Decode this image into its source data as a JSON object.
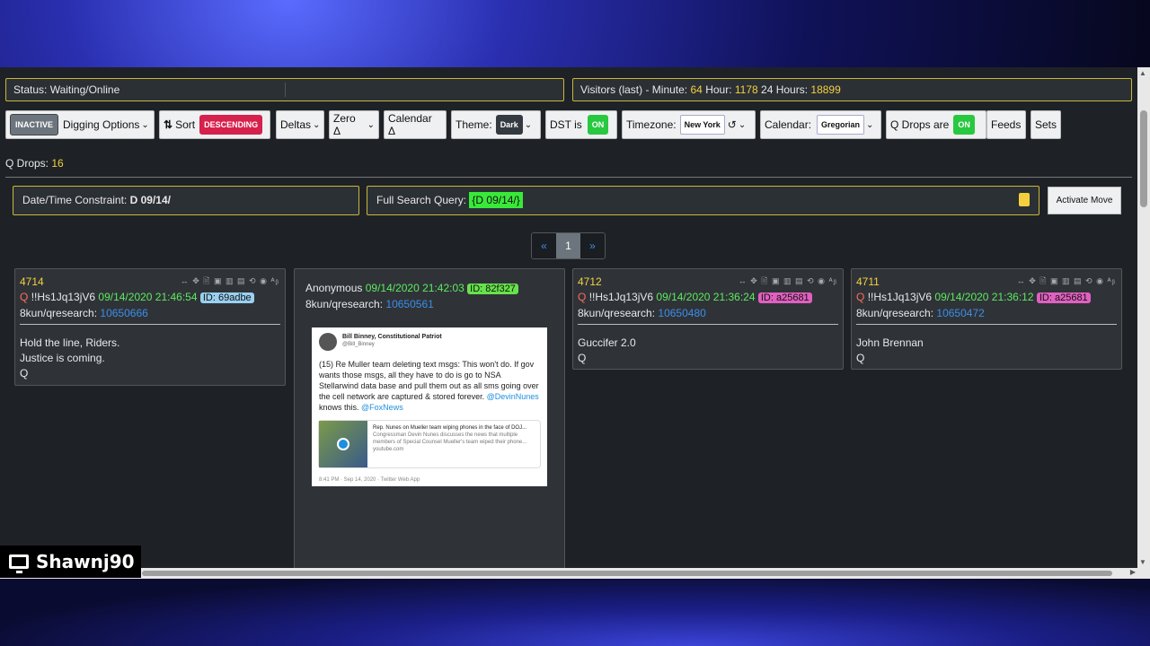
{
  "status": {
    "label": "Status: Waiting/Online"
  },
  "visitors": {
    "prefix": "Visitors (last) - Minute:",
    "minute": "64",
    "hour_label": "Hour:",
    "hour": "1178",
    "day_label": "24 Hours:",
    "day": "18899"
  },
  "toolbar": {
    "inactive": "INACTIVE",
    "digging": "Digging Options",
    "sort_icon": "sort-arrows-icon",
    "sort": "Sort",
    "descending": "DESCENDING",
    "deltas": "Deltas",
    "zero_delta": "Zero Δ",
    "calendar_delta": "Calendar Δ",
    "theme_label": "Theme:",
    "theme_value": "Dark",
    "dst_label": "DST is",
    "dst_value": "ON",
    "timezone_label": "Timezone:",
    "timezone_value": "New York",
    "calendar_label": "Calendar:",
    "calendar_value": "Gregorian",
    "qdrops_label": "Q Drops are",
    "qdrops_value": "ON",
    "feeds": "Feeds",
    "sets": "Sets"
  },
  "qdrops_count": {
    "label": "Q Drops:",
    "value": "16"
  },
  "constraint": {
    "label": "Date/Time Constraint:",
    "value": "D 09/14/"
  },
  "search": {
    "label": "Full Search Query:",
    "value": "{D 09/14/}"
  },
  "activate": "Activate Move",
  "pager": {
    "prev": "«",
    "page": "1",
    "next": "»"
  },
  "cards": [
    {
      "num": "4714",
      "q": "Q",
      "trip": "!!Hs1Jq13jV6",
      "date": "09/14/2020 21:46:54",
      "id": "ID: 69adbe",
      "board": "8kun/qresearch:",
      "post": "10650666",
      "lines": [
        "Hold the line, Riders.",
        "Justice is coming.",
        "Q"
      ]
    },
    {
      "author": "Anonymous",
      "date": "09/14/2020 21:42:03",
      "id": "ID: 82f327",
      "board": "8kun/qresearch:",
      "post": "10650561",
      "tweet": {
        "name": "Bill Binney, Constitutional Patriot",
        "handle": "@Bill_Binney",
        "text": "(15) Re Muller team deleting text msgs: This won't do. If gov wants those msgs, all they have to do is go to NSA Stellarwind data base and pull them out as all sms going over the cell network are captured & stored forever.",
        "mention1": "@DevinNunes",
        "mid": "knows this.",
        "mention2": "@FoxNews",
        "preview_title": "Rep. Nunes on Mueller team wiping phones in the face of DOJ...",
        "preview_desc": "Congressman Devin Nunes discusses the news that multiple members of Special Counsel Mueller's team wiped their phone...",
        "preview_site": "youtube.com",
        "footer": "8:41 PM · Sep 14, 2020 · Twitter Web App"
      }
    },
    {
      "num": "4712",
      "q": "Q",
      "trip": "!!Hs1Jq13jV6",
      "date": "09/14/2020 21:36:24",
      "id": "ID: a25681",
      "board": "8kun/qresearch:",
      "post": "10650480",
      "lines": [
        "Guccifer 2.0",
        "Q"
      ]
    },
    {
      "num": "4711",
      "q": "Q",
      "trip": "!!Hs1Jq13jV6",
      "date": "09/14/2020 21:36:12",
      "id": "ID: a25681",
      "board": "8kun/qresearch:",
      "post": "10650472",
      "lines": [
        "John Brennan",
        "Q"
      ]
    }
  ],
  "card_icons": "↔ ✥ 🖹 ▣ ▥ ▤ ⟲ ◉ ᴬᵦ",
  "overlay": {
    "name": "Shawnj90",
    "icon": "monitor-icon"
  },
  "colors": {
    "accent_yellow": "#f4d03f",
    "date_green": "#5eea5e",
    "link_blue": "#3b8eea",
    "q_red": "#ff6b5a",
    "id_pink": "#e060c0",
    "id_blue": "#9ad0f0",
    "id_green": "#66e34a"
  }
}
